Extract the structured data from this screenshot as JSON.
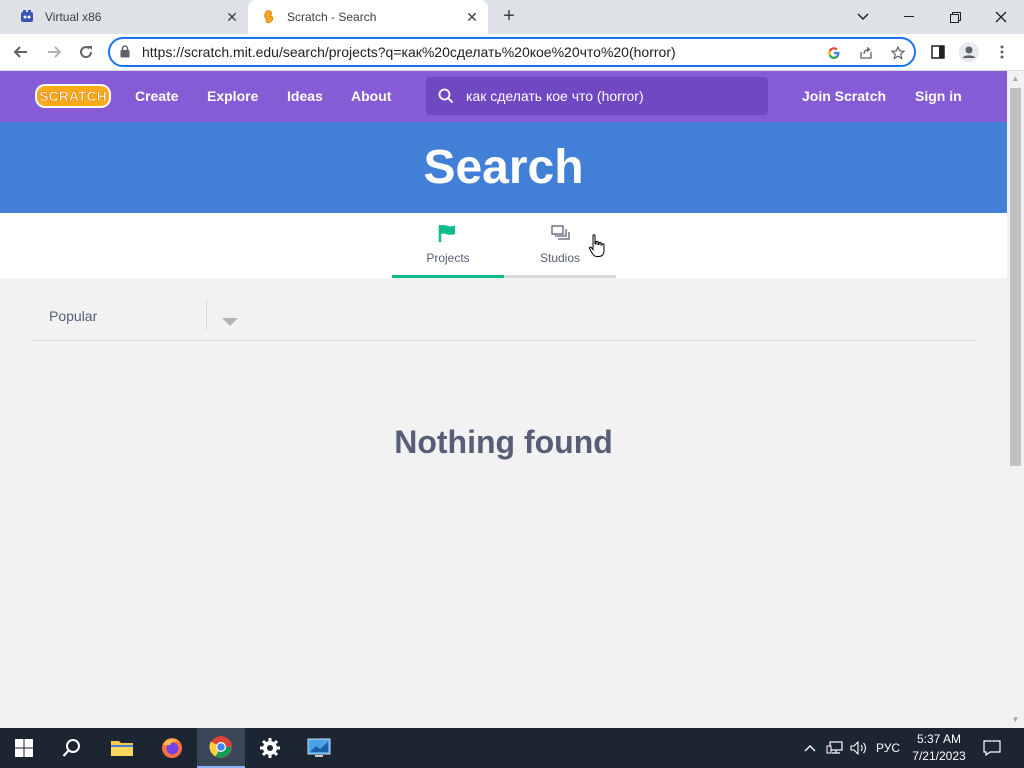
{
  "browser": {
    "tabs": [
      {
        "title": "Virtual x86",
        "favicon": "virtualx86-icon"
      },
      {
        "title": "Scratch - Search",
        "favicon": "scratch-icon"
      }
    ],
    "url": "https://scratch.mit.edu/search/projects?q=как%20сделать%20кое%20что%20(horror)"
  },
  "nav": {
    "logo_text": "SCRATCH",
    "links": [
      "Create",
      "Explore",
      "Ideas",
      "About"
    ],
    "search_value": "как сделать кое что (horror)",
    "join": "Join Scratch",
    "signin": "Sign in"
  },
  "banner": {
    "title": "Search"
  },
  "tabs": [
    {
      "label": "Projects",
      "active": true
    },
    {
      "label": "Studios",
      "active": false
    }
  ],
  "sort": {
    "selected": "Popular"
  },
  "message": "Nothing found",
  "taskbar": {
    "tray_lang": "РУС",
    "time": "5:37 AM",
    "date": "7/21/2023"
  },
  "colors": {
    "scratch_purple": "#855cd6",
    "banner_blue": "#4280d7",
    "active_tab_green": "#0fbd8c"
  }
}
